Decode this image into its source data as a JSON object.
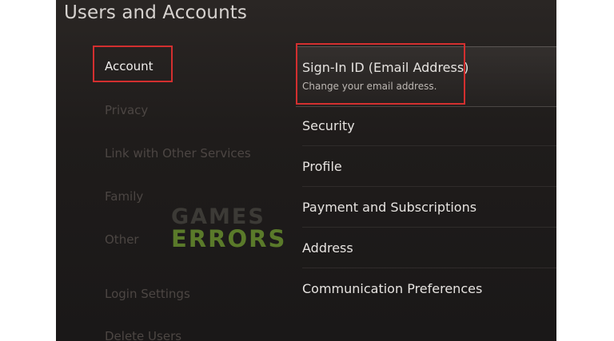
{
  "header": {
    "title": "Users and Accounts"
  },
  "sidebar": {
    "items": [
      {
        "label": "Account",
        "active": true
      },
      {
        "label": "Privacy"
      },
      {
        "label": "Link with Other Services"
      },
      {
        "label": "Family"
      },
      {
        "label": "Other"
      },
      {
        "label": "Login Settings"
      },
      {
        "label": "Delete Users"
      }
    ]
  },
  "main": {
    "items": [
      {
        "label": "Sign-In ID (Email Address)",
        "sublabel": "Change your email address."
      },
      {
        "label": "Security"
      },
      {
        "label": "Profile"
      },
      {
        "label": "Payment and Subscriptions"
      },
      {
        "label": "Address"
      },
      {
        "label": "Communication Preferences"
      }
    ]
  },
  "watermark": {
    "line1": "GAMES",
    "line2": "ERRORS"
  },
  "colors": {
    "highlight_box": "#d32f2f",
    "watermark_green": "#5a7a2a"
  }
}
